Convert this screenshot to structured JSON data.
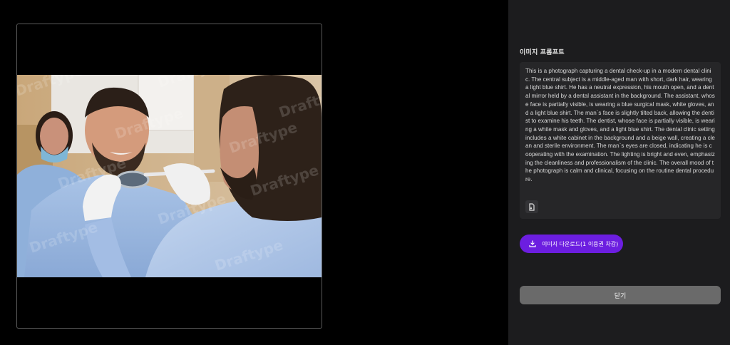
{
  "image_panel": {
    "watermark": "Draftype"
  },
  "side_panel": {
    "prompt_title": "이미지 프롬프트",
    "prompt_text": "This is a photograph capturing a dental check-up in a modern dental clinic. The central subject is a middle-aged man with short, dark hair, wearing a light blue shirt. He has a neutral expression, his mouth open, and a dental mirror held by a dental assistant in the background. The assistant, whose face is partially visible, is wearing a blue surgical mask, white gloves, and a light blue shirt. The man`s face is slightly tilted back, allowing the dentist to examine his teeth. The dentist, whose face is partially visible, is wearing a white mask and gloves, and a light blue shirt. The dental clinic setting includes a white cabinet in the background and a beige wall, creating a clean and sterile environment. The man`s eyes are closed, indicating he is cooperating with the examination. The lighting is bright and even, emphasizing the cleanliness and professionalism of the clinic. The overall mood of the photograph is calm and clinical, focusing on the routine dental procedure.",
    "copy_icon": "copy-document-icon",
    "download_icon": "download-icon",
    "download_label": "이미지 다운로드(1 이용권 차감)",
    "close_label": "닫기"
  },
  "colors": {
    "download_bg": "#6c1ee0",
    "close_bg": "#6a6a6a",
    "panel_bg": "#1c1c1e",
    "prompt_bg": "#262628"
  }
}
